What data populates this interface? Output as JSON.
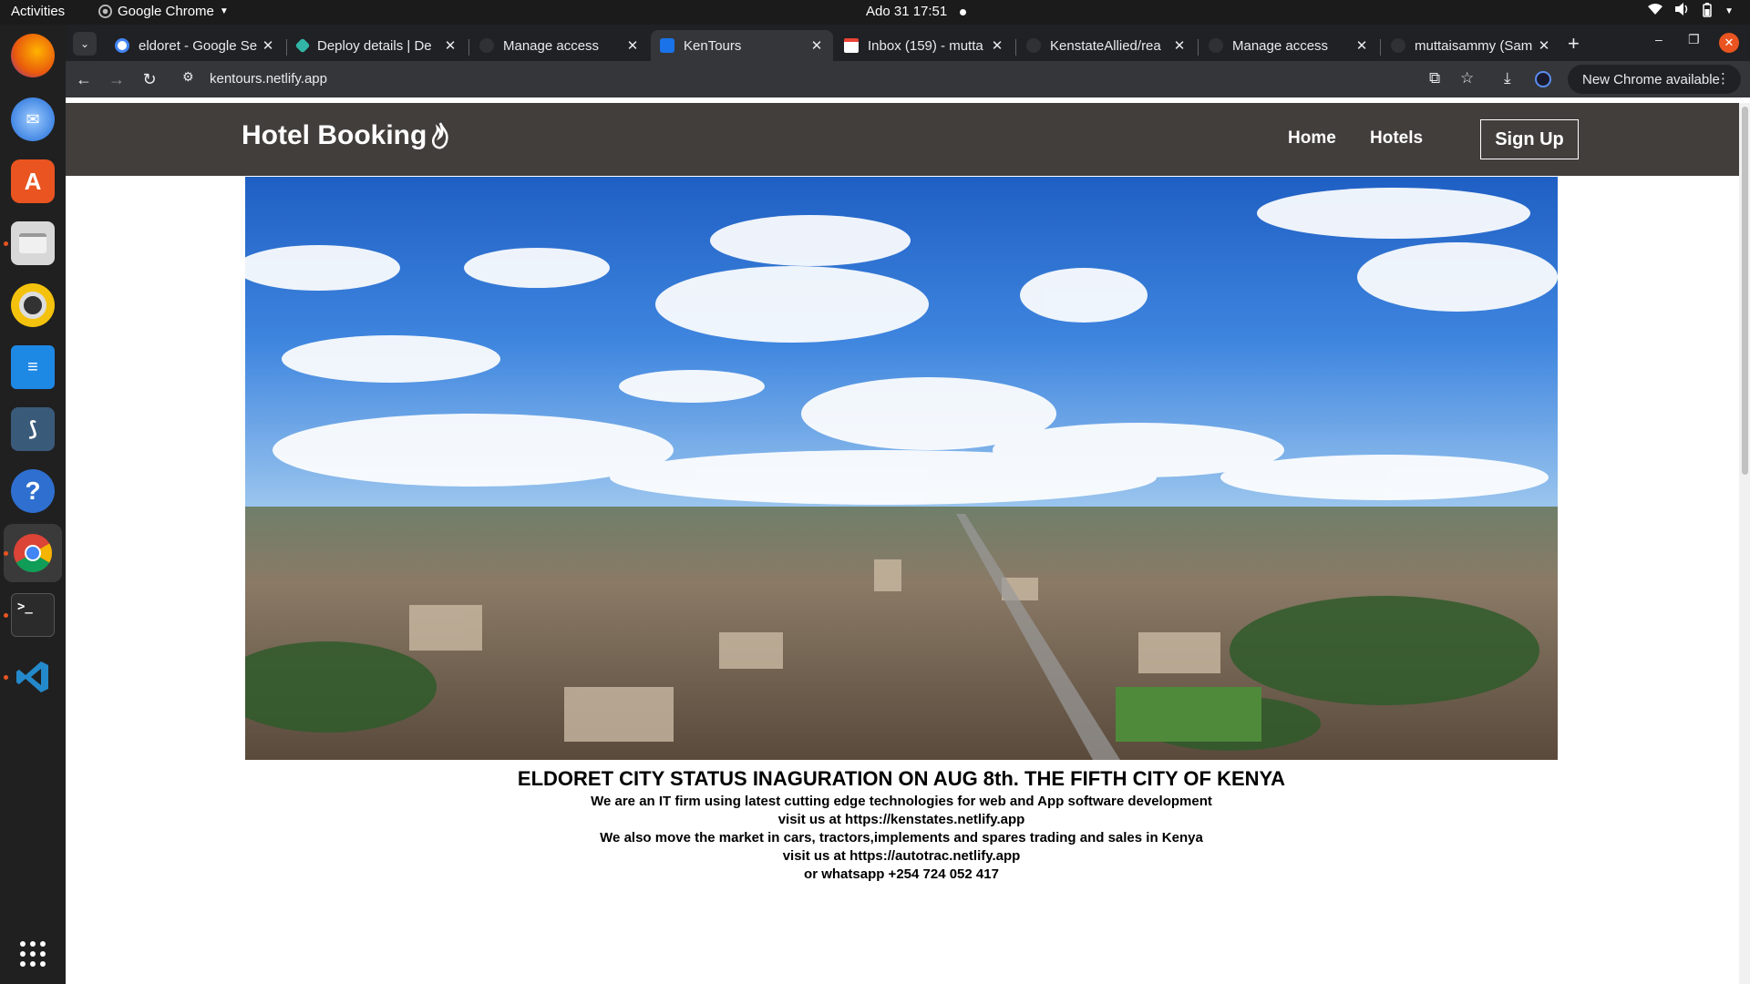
{
  "topbar": {
    "activities": "Activities",
    "app_name": "Google Chrome",
    "clock": "Ado 31  17:51"
  },
  "dock": {
    "items": [
      "firefox-icon",
      "thunderbird-icon",
      "app-center-icon",
      "files-icon",
      "rhythmbox-icon",
      "writer-icon",
      "mysql-workbench-icon",
      "help-icon",
      "chrome-icon",
      "terminal-icon",
      "vscode-icon",
      "app-grid-icon"
    ]
  },
  "tabs": [
    {
      "title": "eldoret - Google Se",
      "favicon_color": "#4285f4"
    },
    {
      "title": "Deploy details | De",
      "favicon_color": "#32b5a6"
    },
    {
      "title": "Manage access",
      "favicon_color": "#24292f"
    },
    {
      "title": "KenTours",
      "favicon_color": "#32b5a6"
    },
    {
      "title": "Inbox (159) - mutta",
      "favicon_color": "#ea4335"
    },
    {
      "title": "KenstateAllied/rea",
      "favicon_color": "#24292f"
    },
    {
      "title": "Manage access",
      "favicon_color": "#24292f"
    },
    {
      "title": "muttaisammy (Sam",
      "favicon_color": "#24292f"
    }
  ],
  "toolbar": {
    "url": "kentours.netlify.app",
    "new_chrome": "New Chrome available"
  },
  "site": {
    "brand": "Hotel Booking",
    "nav": {
      "home": "Home",
      "hotels": "Hotels",
      "signup": "Sign Up"
    },
    "headline": "ELDORET CITY STATUS INAGURATION ON AUG 8th. THE FIFTH CITY OF KENYA",
    "lines": [
      "We are an IT firm using latest cutting edge technologies for web and App software development",
      "visit us at https://kenstates.netlify.app",
      "We also move the market in cars, tractors,implements and spares trading and sales in Kenya",
      "visit us at https://autotrac.netlify.app",
      "or whatsapp +254 724 052 417"
    ]
  },
  "colors": {
    "nav_bg": "#423e3c",
    "tabstrip_bg": "#202124",
    "toolbar_bg": "#35363a",
    "ubuntu_orange": "#e95420"
  }
}
